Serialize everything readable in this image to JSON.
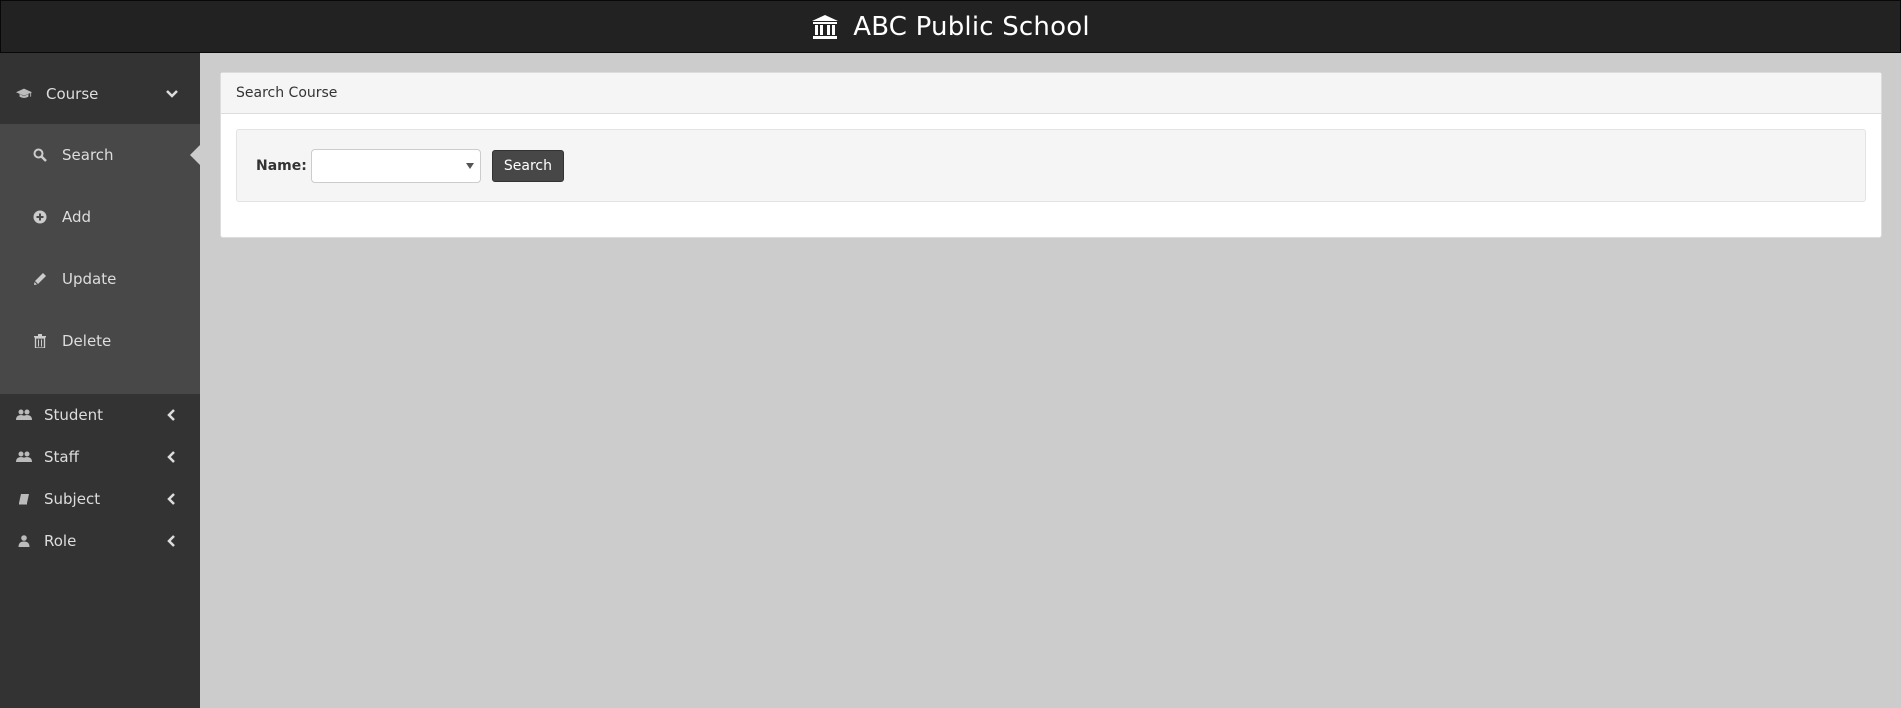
{
  "header": {
    "title": "ABC Public School",
    "logo_icon": "bank-icon"
  },
  "sidebar": {
    "course": {
      "label": "Course",
      "icon": "graduation-cap-icon",
      "expanded": true,
      "items": [
        {
          "label": "Search",
          "icon": "search-icon",
          "active": true
        },
        {
          "label": "Add",
          "icon": "plus-circle-icon"
        },
        {
          "label": "Update",
          "icon": "pencil-icon"
        },
        {
          "label": "Delete",
          "icon": "trash-icon"
        }
      ]
    },
    "items": [
      {
        "label": "Student",
        "icon": "users-icon"
      },
      {
        "label": "Staff",
        "icon": "users-icon"
      },
      {
        "label": "Subject",
        "icon": "book-icon"
      },
      {
        "label": "Role",
        "icon": "user-icon"
      }
    ]
  },
  "main": {
    "panel_title": "Search Course",
    "form": {
      "name_label": "Name:",
      "name_value": "",
      "search_button": "Search"
    }
  },
  "colors": {
    "topbar": "#222222",
    "sidebar": "#333333",
    "submenu": "#484848",
    "content_bg": "#cccccc",
    "button": "#474747"
  }
}
